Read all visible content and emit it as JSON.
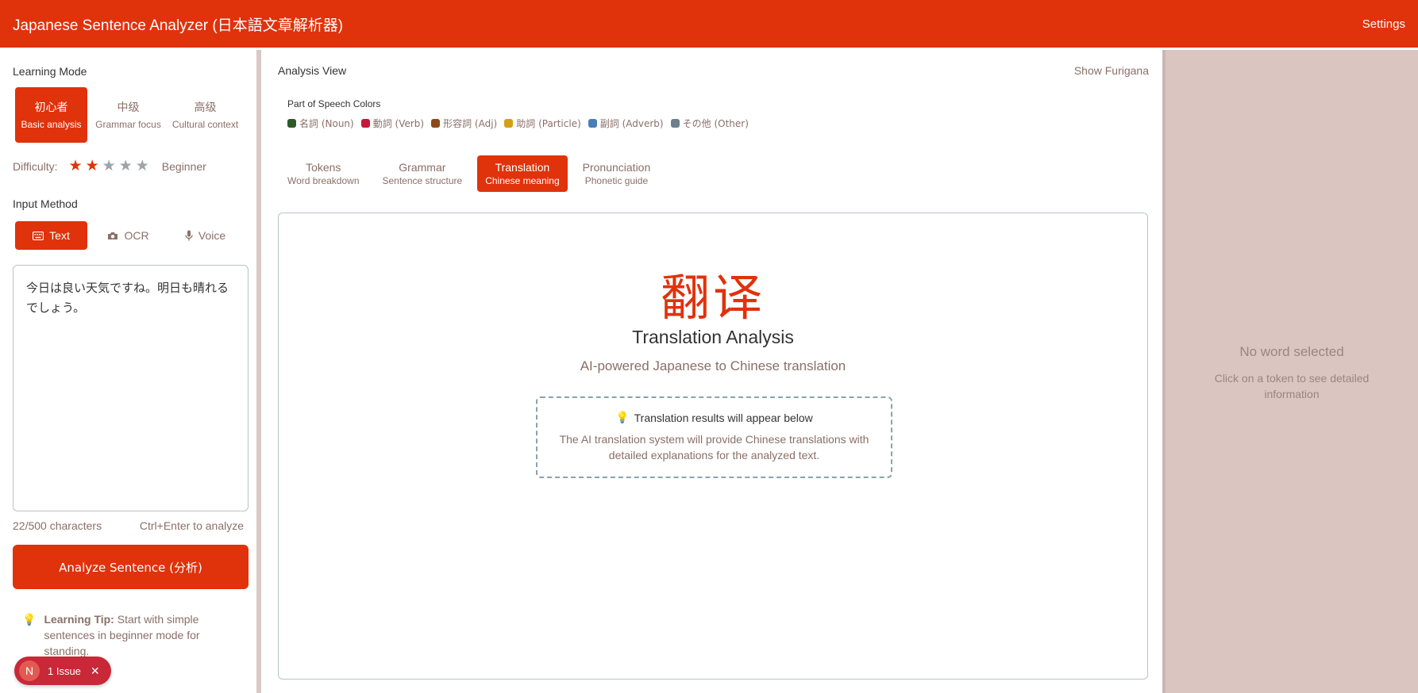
{
  "header": {
    "title": "Japanese Sentence Analyzer (日本語文章解析器)",
    "settings_label": "Settings"
  },
  "learning_mode": {
    "label": "Learning Mode",
    "modes": [
      {
        "title": "初心者",
        "subtitle": "Basic analysis",
        "active": true
      },
      {
        "title": "中级",
        "subtitle": "Grammar focus",
        "active": false
      },
      {
        "title": "高级",
        "subtitle": "Cultural context",
        "active": false
      }
    ]
  },
  "difficulty": {
    "label": "Difficulty:",
    "stars_filled": 2,
    "stars_total": 5,
    "level": "Beginner"
  },
  "input_method": {
    "label": "Input Method",
    "methods": [
      {
        "label": "Text",
        "icon": "keyboard-icon",
        "active": true
      },
      {
        "label": "OCR",
        "icon": "camera-icon",
        "active": false
      },
      {
        "label": "Voice",
        "icon": "microphone-icon",
        "active": false
      }
    ]
  },
  "input": {
    "value": "今日は良い天気ですね。明日も晴れるでしょう。",
    "char_count": "22/500 characters",
    "shortcut_hint": "Ctrl+Enter to analyze"
  },
  "analyze_button": "Analyze Sentence (分析)",
  "tip": {
    "label": "Learning Tip:",
    "text": "Start with simple sentences in beginner mode for standing."
  },
  "issue_badge": {
    "letter": "N",
    "label": "1 Issue"
  },
  "analysis_view": {
    "title": "Analysis View",
    "furigana_toggle": "Show Furigana",
    "pos_title": "Part of Speech Colors",
    "pos_legend": [
      {
        "label": "名詞 (Noun)",
        "color": "#2e5a27"
      },
      {
        "label": "動詞 (Verb)",
        "color": "#c8183a"
      },
      {
        "label": "形容詞 (Adj)",
        "color": "#8a4a1a"
      },
      {
        "label": "助詞 (Particle)",
        "color": "#d4a017"
      },
      {
        "label": "副詞 (Adverb)",
        "color": "#4a7fb5"
      },
      {
        "label": "その他 (Other)",
        "color": "#6c7f8c"
      }
    ],
    "tabs": [
      {
        "title": "Tokens",
        "subtitle": "Word breakdown",
        "active": false
      },
      {
        "title": "Grammar",
        "subtitle": "Sentence structure",
        "active": false
      },
      {
        "title": "Translation",
        "subtitle": "Chinese meaning",
        "active": true
      },
      {
        "title": "Pronunciation",
        "subtitle": "Phonetic guide",
        "active": false
      }
    ],
    "content": {
      "glyph": "翻译",
      "title": "Translation Analysis",
      "subtitle": "AI-powered Japanese to Chinese translation",
      "notice_title": "Translation results will appear below",
      "notice_body": "The AI translation system will provide Chinese translations with detailed explanations for the analyzed text."
    }
  },
  "detail_panel": {
    "title": "No word selected",
    "subtitle": "Click on a token to see detailed information"
  }
}
